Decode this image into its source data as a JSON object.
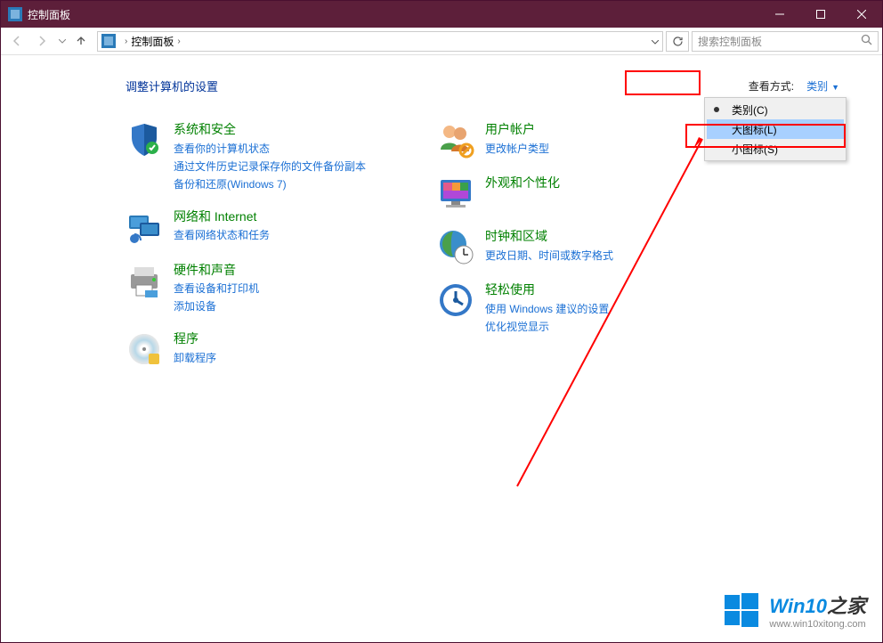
{
  "window": {
    "title": "控制面板"
  },
  "breadcrumb": {
    "item1": "控制面板"
  },
  "search": {
    "placeholder": "搜索控制面板"
  },
  "page": {
    "title": "调整计算机的设置",
    "view_label": "查看方式:",
    "view_value": "类别"
  },
  "dropdown": {
    "category": "类别(C)",
    "large": "大图标(L)",
    "small": "小图标(S)"
  },
  "cats": {
    "system": {
      "title": "系统和安全",
      "l1": "查看你的计算机状态",
      "l2": "通过文件历史记录保存你的文件备份副本",
      "l3": "备份和还原(Windows 7)"
    },
    "network": {
      "title": "网络和 Internet",
      "l1": "查看网络状态和任务"
    },
    "hardware": {
      "title": "硬件和声音",
      "l1": "查看设备和打印机",
      "l2": "添加设备"
    },
    "programs": {
      "title": "程序",
      "l1": "卸载程序"
    },
    "user": {
      "title": "用户帐户",
      "l1": "更改帐户类型"
    },
    "appearance": {
      "title": "外观和个性化"
    },
    "clock": {
      "title": "时钟和区域",
      "l1": "更改日期、时间或数字格式"
    },
    "ease": {
      "title": "轻松使用",
      "l1": "使用 Windows 建议的设置",
      "l2": "优化视觉显示"
    }
  },
  "watermark": {
    "brand1": "Win10",
    "brand2": "之家",
    "url": "www.win10xitong.com"
  }
}
